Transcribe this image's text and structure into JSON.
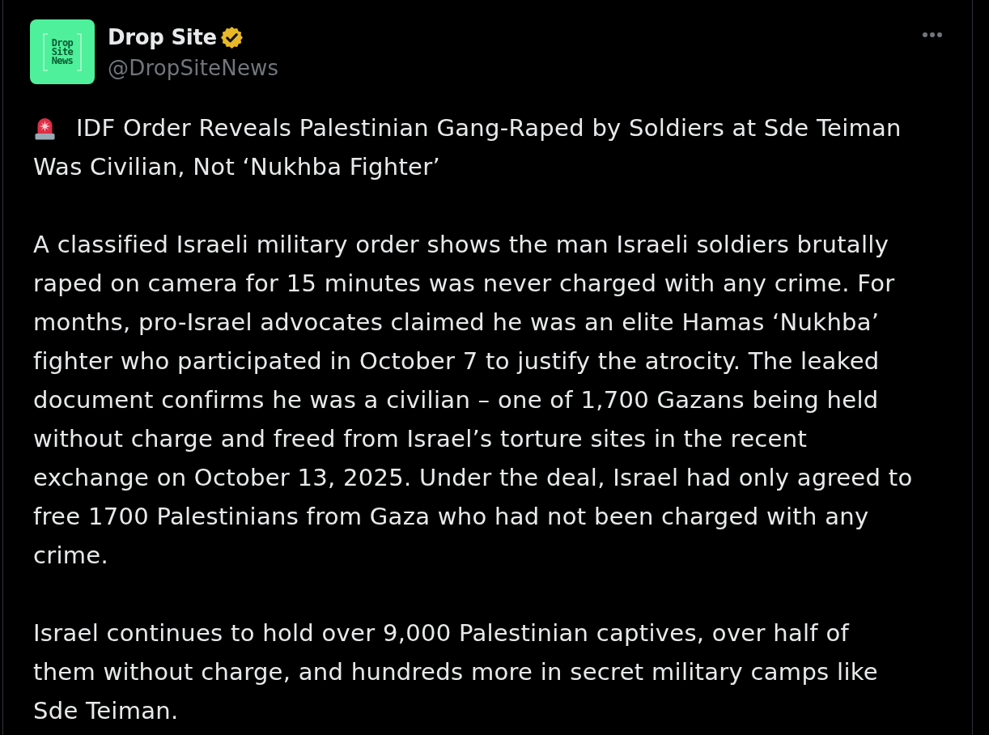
{
  "post": {
    "author": {
      "name": "Drop Site",
      "verified": true,
      "handle": "@DropSiteNews",
      "avatar_text": [
        "Drop",
        "Site",
        "News"
      ]
    },
    "headline": {
      "lines": [
        "IDF Order Reveals Palestinian Gang-Raped by Soldiers at Sde Teiman",
        "Was Civilian, Not ‘Nukhba Fighter’"
      ]
    },
    "paragraphs": [
      {
        "lines": [
          "A classified Israeli military order shows the man Israeli soldiers brutally",
          "raped on camera for 15 minutes was never charged with any crime. For",
          "months, pro-Israel advocates claimed he was an elite Hamas ‘Nukhba’",
          "fighter who participated in October 7 to justify the atrocity. The leaked",
          "document confirms he was a civilian – one of 1,700 Gazans being held",
          "without charge and freed from Israel’s torture sites in the recent",
          "exchange on October 13, 2025. Under the deal, Israel had only agreed to",
          "free 1700 Palestinians from Gaza who had not been charged with any",
          "crime."
        ]
      },
      {
        "lines": [
          "Israel continues to hold over 9,000 Palestinian captives, over half of",
          "them without charge, and hundreds more in secret military camps like",
          "Sde Teiman."
        ]
      }
    ]
  }
}
